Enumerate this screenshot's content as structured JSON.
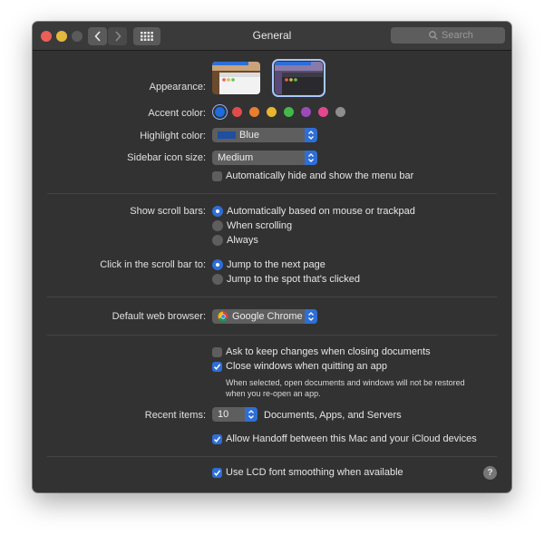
{
  "window": {
    "title": "General"
  },
  "toolbar": {
    "search_placeholder": "Search"
  },
  "appearance": {
    "label": "Appearance:",
    "options": [
      {
        "name": "Light",
        "selected": false
      },
      {
        "name": "Dark",
        "selected": true
      }
    ]
  },
  "accent": {
    "label": "Accent color:",
    "colors": [
      "#1e6ce0",
      "#e04b4b",
      "#e87f2e",
      "#e8b52e",
      "#43b84b",
      "#9a4bb8",
      "#e3488f",
      "#8e8e8e"
    ],
    "selected_index": 0
  },
  "highlight": {
    "label": "Highlight color:",
    "value": "Blue",
    "swatch": "#1e4fa0"
  },
  "sidebar_icon": {
    "label": "Sidebar icon size:",
    "value": "Medium"
  },
  "menubar": {
    "label": "Automatically hide and show the menu bar",
    "checked": false
  },
  "scroll_bars": {
    "label": "Show scroll bars:",
    "options": [
      "Automatically based on mouse or trackpad",
      "When scrolling",
      "Always"
    ],
    "selected_index": 0
  },
  "click_scroll": {
    "label": "Click in the scroll bar to:",
    "options": [
      "Jump to the next page",
      "Jump to the spot that's clicked"
    ],
    "selected_index": 0
  },
  "browser": {
    "label": "Default web browser:",
    "value": "Google Chrome"
  },
  "ask_keep": {
    "label": "Ask to keep changes when closing documents",
    "checked": false
  },
  "close_windows": {
    "label": "Close windows when quitting an app",
    "checked": true,
    "note_line1": "When selected, open documents and windows will not be restored",
    "note_line2": "when you re-open an app."
  },
  "recent": {
    "label": "Recent items:",
    "value": "10",
    "suffix": "Documents, Apps, and Servers"
  },
  "handoff": {
    "label": "Allow Handoff between this Mac and your iCloud devices",
    "checked": true
  },
  "lcd": {
    "label": "Use LCD font smoothing when available",
    "checked": true
  },
  "help": {
    "symbol": "?"
  }
}
